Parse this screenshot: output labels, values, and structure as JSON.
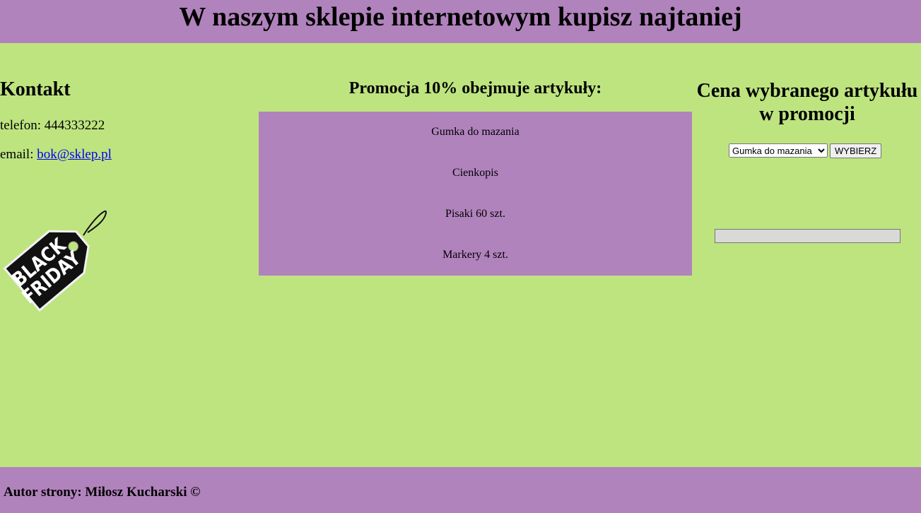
{
  "header": {
    "title": "W naszym sklepie internetowym kupisz najtaniej"
  },
  "contact": {
    "heading": "Kontakt",
    "phone_label": "telefon:",
    "phone": "444333222",
    "email_label": "email:",
    "email": "bok@sklep.pl",
    "banner_image": "black-friday-tag",
    "banner_lettering": [
      "BLACK",
      "FRIDAY"
    ]
  },
  "promotion": {
    "heading": "Promocja 10% obejmuje artykuły:",
    "items": [
      "Gumka do mazania",
      "Cienkopis",
      "Pisaki 60 szt.",
      "Markery 4 szt."
    ]
  },
  "price": {
    "heading_line1": "Cena wybranego artykułu",
    "heading_line2": "w promocji",
    "selected": "Gumka do mazania",
    "button_label": "WYBIERZ",
    "result_value": ""
  },
  "footer": {
    "author": "Autor strony: Miłosz Kucharski ©"
  },
  "colors": {
    "background": "#bee480",
    "panel": "#b183bd",
    "link": "#0000ee"
  }
}
